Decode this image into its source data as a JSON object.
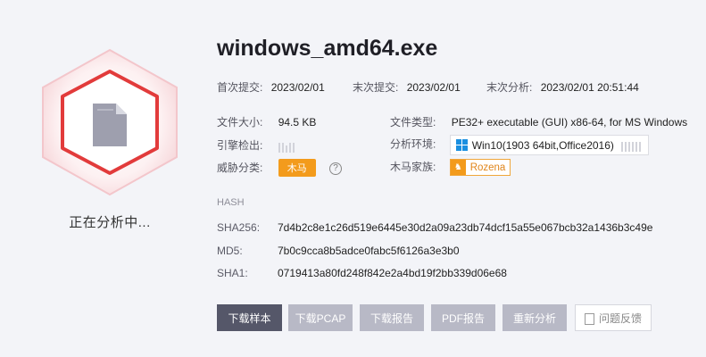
{
  "status": {
    "text": "正在分析中..."
  },
  "file": {
    "name": "windows_amd64.exe"
  },
  "dates": {
    "first_submit_label": "首次提交:",
    "first_submit": "2023/02/01",
    "last_submit_label": "末次提交:",
    "last_submit": "2023/02/01",
    "last_analysis_label": "末次分析:",
    "last_analysis": "2023/02/01 20:51:44"
  },
  "details": {
    "size_label": "文件大小:",
    "size": "94.5 KB",
    "type_label": "文件类型:",
    "type": "PE32+ executable (GUI) x86-64, for MS Windows",
    "engine_label": "引擎检出:",
    "env_label": "分析环境:",
    "env": "Win10(1903 64bit,Office2016)",
    "threat_label": "威胁分类:",
    "threat": "木马",
    "help_icon": "?",
    "family_label": "木马家族:",
    "family": "Rozena"
  },
  "hash": {
    "heading": "HASH",
    "sha256_label": "SHA256:",
    "sha256": "7d4b2c8e1c26d519e6445e30d2a09a23db74dcf15a55e067bcb32a1436b3c49e",
    "md5_label": "MD5:",
    "md5": "7b0c9cca8b5adce0fabc5f6126a3e3b0",
    "sha1_label": "SHA1:",
    "sha1": "0719413a80fd248f842e2a4bd19f2bb339d06e68"
  },
  "actions": {
    "download_sample": "下载样本",
    "download_pcap": "下载PCAP",
    "download_report": "下载报告",
    "pdf_report": "PDF报告",
    "reanalyze": "重新分析",
    "feedback": "问题反馈"
  },
  "colors": {
    "hex_red": "#e23b3b",
    "trojan_orange": "#f39b1c",
    "primary_button": "#555769",
    "disabled_button": "#b8b9c6"
  }
}
